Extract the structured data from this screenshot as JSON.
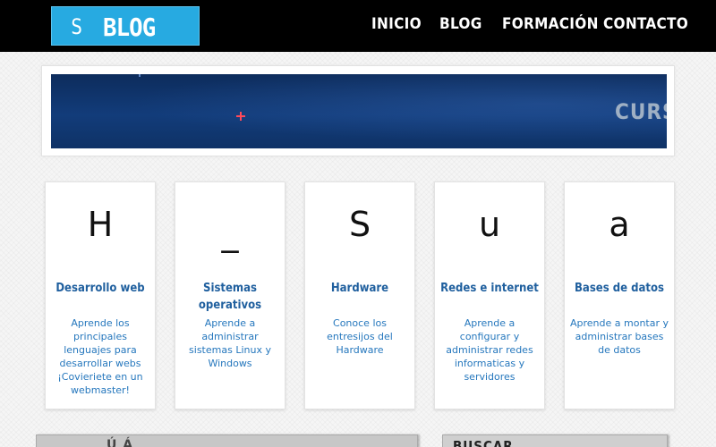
{
  "header": {
    "logo": {
      "symbol": "S",
      "text": "BLOG",
      "color": "#27aae1"
    },
    "nav": [
      {
        "label": "INICIO"
      },
      {
        "label": "BLOG"
      },
      {
        "label": "FORMACIÓN"
      },
      {
        "label": "CONTACTO"
      }
    ]
  },
  "banner": {
    "text": "CURSO"
  },
  "cards": [
    {
      "letter": "H",
      "title": "Desarrollo web",
      "description": "Aprende los principales lenguajes para desarrollar webs ¡Covieriete en un webmaster!"
    },
    {
      "letter": "_",
      "title": "Sistemas operativos",
      "description": "Aprende a administrar sistemas Linux y Windows"
    },
    {
      "letter": "S",
      "title": "Hardware",
      "description": "Conoce los entresijos del Hardware"
    },
    {
      "letter": "u",
      "title": "Redes e internet",
      "description": "Aprende a configurar y administrar redes informaticas y servidores"
    },
    {
      "letter": "a",
      "title": "Bases de datos",
      "description": "Aprende a montar y administrar bases de datos"
    }
  ],
  "sections": {
    "content_title": "Ú Á",
    "search_title": "BUSCAR"
  },
  "colors": {
    "header_bg": "#000000",
    "accent": "#27aae1",
    "card_title": "#1f5f9e",
    "card_text": "#2577bd"
  }
}
